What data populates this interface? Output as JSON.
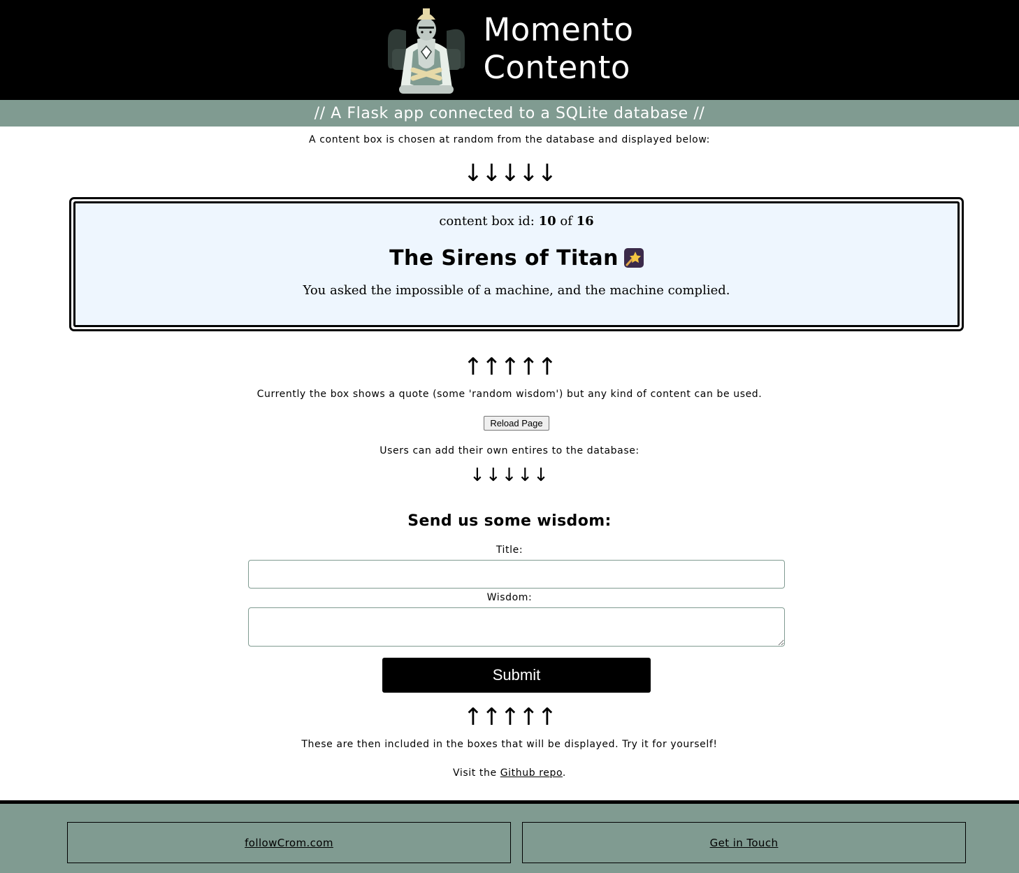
{
  "header": {
    "title_line1": "Momento",
    "title_line2": "Contento",
    "subtitle": "// A Flask app connected to a SQLite database //"
  },
  "intro": {
    "text": "A content box is chosen at random from the database and displayed below:",
    "arrows_down": "↓↓↓↓↓"
  },
  "content_box": {
    "id_label": "content box id:",
    "id": "10",
    "of_label": "of",
    "total": "16",
    "title": "The Sirens of Titan",
    "quote": "You asked the impossible of a machine, and the machine complied.",
    "background": "#eef6fe"
  },
  "after_box": {
    "arrows_up": "↑↑↑↑↑",
    "text": "Currently the box shows a quote (some 'random wisdom') but any kind of content can be used.",
    "reload_label": "Reload Page",
    "users_text": "Users can add their own entires to the database:",
    "arrows_down": "↓↓↓↓↓"
  },
  "form": {
    "heading": "Send us some wisdom:",
    "title_label": "Title:",
    "wisdom_label": "Wisdom:",
    "submit_label": "Submit"
  },
  "outro": {
    "arrows_up": "↑↑↑↑↑",
    "text": "These are then included in the boxes that will be displayed. Try it for yourself!",
    "visit_prefix": "Visit the ",
    "repo_link": "Github repo",
    "visit_suffix": "."
  },
  "footer": {
    "left_link": "followCrom.com",
    "right_link": "Get in Touch",
    "background": "#809b91"
  },
  "icons": {
    "logo": "wizard-logo-icon",
    "title_emoji": "shooting-star-icon"
  }
}
